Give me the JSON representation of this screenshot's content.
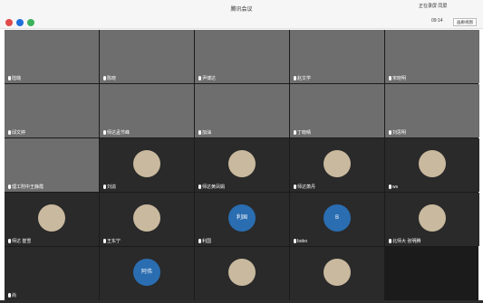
{
  "window": {
    "title": "腾讯会议",
    "app_notice": "正在录屏 同屏"
  },
  "info": {
    "timer": "09:14",
    "view_button": "画廊视图"
  },
  "tiles": [
    {
      "label": "陆璐",
      "type": "video"
    },
    {
      "label": "陈晓",
      "type": "video"
    },
    {
      "label": "尹博达",
      "type": "video"
    },
    {
      "label": "赵文学",
      "type": "video"
    },
    {
      "label": "宋晓明",
      "type": "video"
    },
    {
      "label": "邱文婷",
      "type": "video"
    },
    {
      "label": "师达孟节峰",
      "type": "video"
    },
    {
      "label": "加油",
      "type": "video"
    },
    {
      "label": "丁晓晴",
      "type": "video"
    },
    {
      "label": "刘思明",
      "type": "video"
    },
    {
      "label": "理工附中王静霞",
      "type": "video"
    },
    {
      "label": "刘渝",
      "type": "photo"
    },
    {
      "label": "师达黄凤娟",
      "type": "photo"
    },
    {
      "label": "师达萧丹",
      "type": "photo"
    },
    {
      "label": "ws",
      "type": "photo"
    },
    {
      "label": "师达 崔雪",
      "type": "photo"
    },
    {
      "label": "王东宁",
      "type": "photo"
    },
    {
      "label": "利国",
      "type": "text",
      "avatar_text": "利国"
    },
    {
      "label": "bobo",
      "type": "text",
      "avatar_text": "B"
    },
    {
      "label": "北师大 张明腾",
      "type": "photo"
    },
    {
      "label": "尚",
      "type": "plain"
    },
    {
      "label": "",
      "type": "text",
      "avatar_text": "阿伟"
    },
    {
      "label": "",
      "type": "photo"
    },
    {
      "label": "",
      "type": "photo"
    }
  ],
  "colors": {
    "avatar_blue": "#2a6db1",
    "tile_bg": "#2a2a2a",
    "grid_bg": "#1b1b1b"
  }
}
